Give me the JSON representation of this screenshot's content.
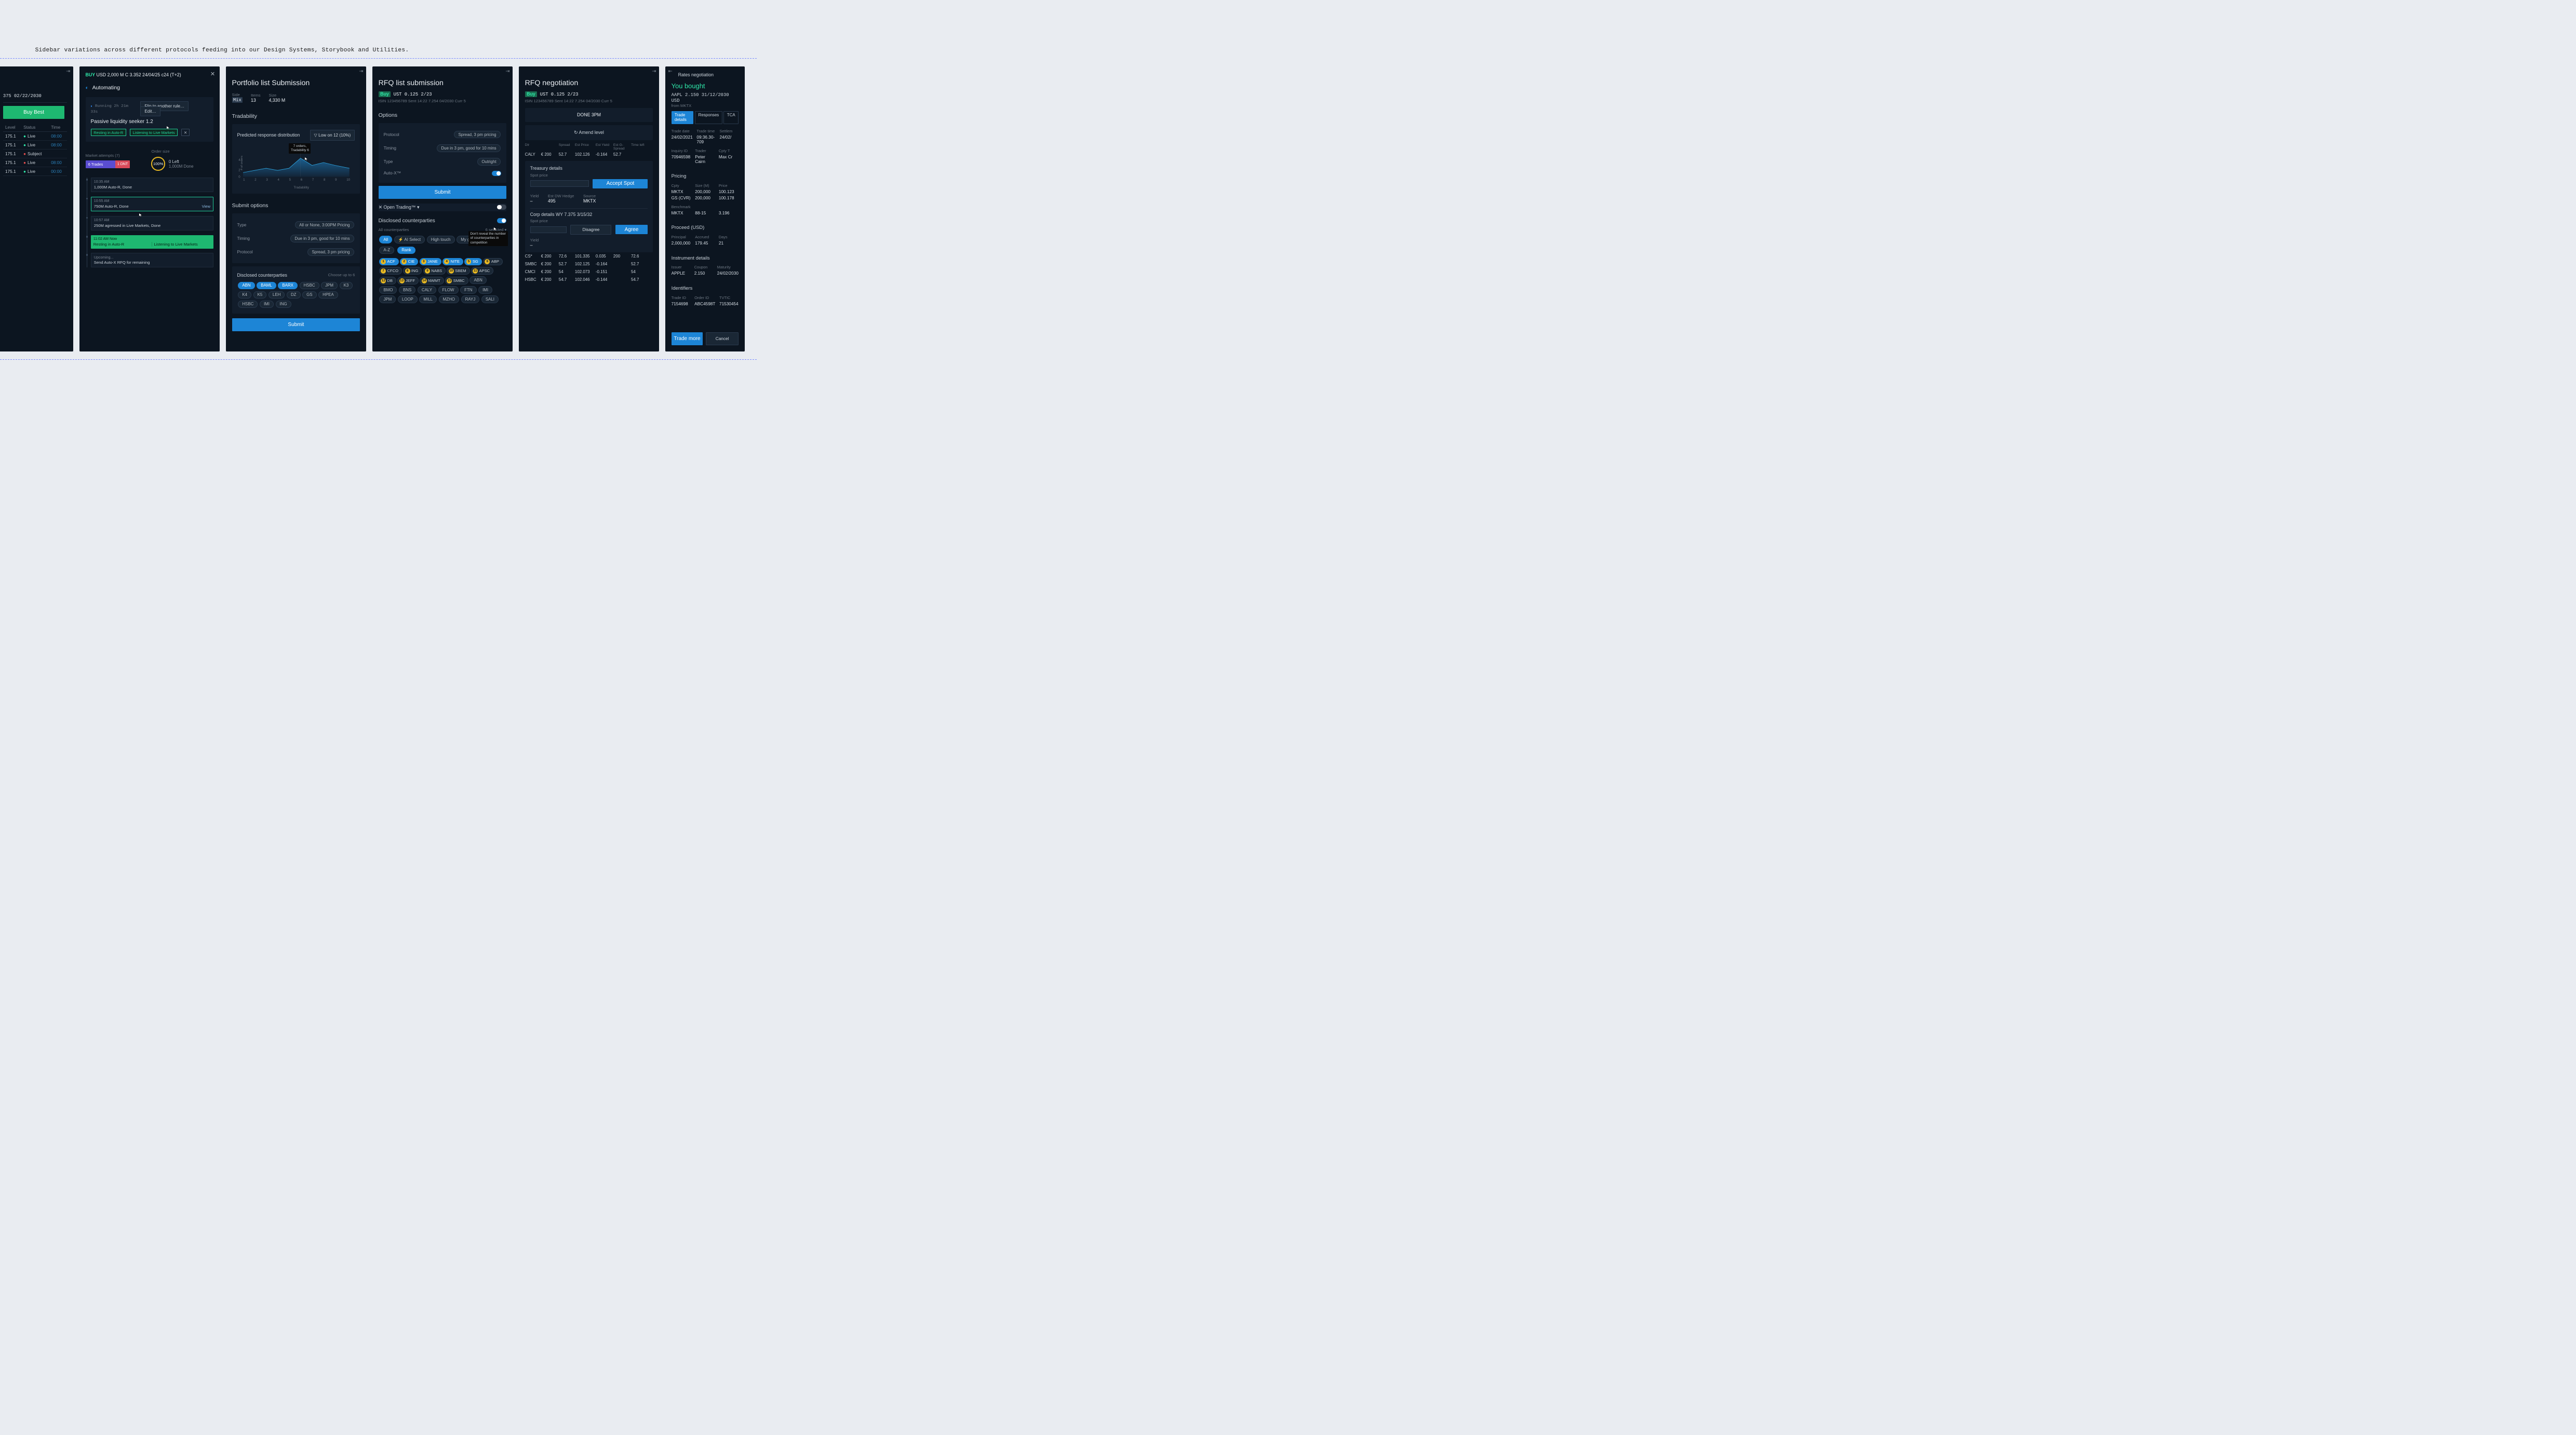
{
  "caption": "Sidebar variations across different protocols feeding into our Design Systems, Storybook and Utilities.",
  "p1": {
    "ticker": "375 02/22/2030",
    "buy_best": "Buy Best",
    "cols": [
      "Level",
      "Status",
      "Time"
    ],
    "rows": [
      {
        "level": "175.1",
        "status": "Live",
        "statusColor": "green",
        "time": "08:00"
      },
      {
        "level": "175.1",
        "status": "Live",
        "statusColor": "green",
        "time": "08:00"
      },
      {
        "level": "175.1",
        "status": "Subject",
        "statusColor": "red",
        "time": ""
      },
      {
        "level": "175.1",
        "status": "Live",
        "statusColor": "red",
        "time": "08:00"
      },
      {
        "level": "175.1",
        "status": "Live",
        "statusColor": "green",
        "time": "00:00"
      }
    ]
  },
  "p2": {
    "head_side": "BUY",
    "head_line": "USD 2,000 M C 3.352 24/04/25 c24 (T+2)",
    "automating": "Automating",
    "running": "Running 2h 21m 33s",
    "flip": "Flip to another rule…",
    "edit": "Edit…",
    "strategy": "Passive liquidity seeker 1.2",
    "rest": "Resting in Auto-R",
    "listen": "Listening to Live Markets",
    "market_attempts": "Market attempts (7)",
    "order_size": "Order size",
    "trades": "6 Trades",
    "dnt": "1 DNT",
    "ring": "100%",
    "left": "0 Left",
    "done": "1,000M Done",
    "timeline": [
      {
        "t": "10:35 AM",
        "txt": "1,000M Auto-R, Done",
        "view": false
      },
      {
        "t": "10:55 AM",
        "txt": "750M Auto-R, Done",
        "view": true
      },
      {
        "t": "10:57 AM",
        "txt": "250M agressed in Live Markets, Done",
        "view": false
      }
    ],
    "now_t": "11:02 AM  Now",
    "now_rest": "Resting in Auto-R",
    "now_listen": "Listening to Live Markets",
    "upcoming": "Upcoming...",
    "upcoming_txt": "Send Auto-X RFQ for remaining"
  },
  "p3": {
    "title": "Portfolio list Submission",
    "stats": [
      {
        "l": "Side",
        "v": "Mix"
      },
      {
        "l": "Items",
        "v": "13"
      },
      {
        "l": "Size",
        "v": "4,330 M"
      }
    ],
    "tradability": "Tradability",
    "pred_title": "Predicted response distribution",
    "filter": "Low on 12 (10%)",
    "tooltip": "7 orders,\nTradability 6",
    "y_label": "# of orders",
    "x_label": "Tradability",
    "submit_options": "Submit options",
    "type": "All or None, 3:00PM Pricing",
    "timing": "Due in 3 pm, good for 10 mins",
    "protocol": "Spread, 3 pm pricing",
    "disclosed": "Disclosed counterparties",
    "choose": "Choose up to 6",
    "cps_selected": [
      "ABN",
      "BAML",
      "BARX"
    ],
    "cps": [
      "HSBC",
      "JPM",
      "K3",
      "K4",
      "K5",
      "LEH",
      "DZ",
      "GS",
      "HPEA",
      "HSBC",
      "IMI",
      "ING"
    ],
    "submit": "Submit"
  },
  "p4": {
    "title": "RFQ list submission",
    "side": "Buy",
    "inst": "UST  0.125  2/23",
    "meta": "ISIN 123456789   Sent 14:22   7.254 04/2030 Curr 5",
    "options": "Options",
    "protocol": "Spread, 3 pm pricing",
    "timing": "Due in 3 pm, good for 10 mins",
    "type": "Outright",
    "autox": "Auto-X™",
    "submit": "Submit",
    "ot": "Open Trading™",
    "disclosed": "Disclosed counterparties",
    "all_cp": "All counterparties",
    "n_selected": "6 selected",
    "filters": [
      "All",
      "AI Select",
      "High touch",
      "My g"
    ],
    "sort_az": "A-Z",
    "sort_rank": "Rank",
    "tooltip": "Don't reveal the number of counterparties in competition",
    "cps_ranked": [
      {
        "r": 1,
        "n": "ACF",
        "sel": true
      },
      {
        "r": 2,
        "n": "CIE",
        "sel": true
      },
      {
        "r": 3,
        "n": "JANE",
        "sel": true
      },
      {
        "r": 4,
        "n": "NITE",
        "sel": true
      },
      {
        "r": 5,
        "n": "SG",
        "sel": true
      },
      {
        "r": 6,
        "n": "ABP"
      },
      {
        "r": 7,
        "n": "CFCO"
      },
      {
        "r": 8,
        "n": "ING"
      },
      {
        "r": 9,
        "n": "NABS"
      },
      {
        "r": 10,
        "n": "SBEM"
      },
      {
        "r": 11,
        "n": "APSC"
      },
      {
        "r": 12,
        "n": "DB"
      },
      {
        "r": 13,
        "n": "JEFF"
      },
      {
        "r": 14,
        "n": "NWMT"
      },
      {
        "r": 15,
        "n": "SMBC"
      }
    ],
    "cps_plain": [
      "ABN",
      "BMO",
      "BNS",
      "CALY",
      "FLOW",
      "FTN",
      "IMI",
      "JPM",
      "LOOP",
      "MILL",
      "MZHO",
      "RAYJ",
      "SALI"
    ]
  },
  "p5": {
    "title": "RFQ negotiation",
    "side": "Buy",
    "inst": "UST   0.125   2/23",
    "meta": "ISIN 123456789   Sent 14:22   7.254 04/2030 Curr 5",
    "done": "DONE 3PM",
    "amend": "Amend level",
    "qhead": [
      "Dlr",
      "",
      "Spread",
      "Est Price",
      "Est Yield",
      "Est G-Spread",
      "Time left"
    ],
    "caly": [
      "CALY",
      "€ 200",
      "52.7",
      "102.126",
      "-0.164",
      "52.7",
      ""
    ],
    "treasury": "Treasury details",
    "spot_price": "Spot price",
    "accept_spot": "Accept Spot",
    "yield": "Yield",
    "yield_v": "–",
    "hedge": "Est DW Hedge",
    "hedge_v": "495",
    "source": "Source",
    "source_v": "MKTX",
    "corp": "Corp details   WY 7.375 3/15/32",
    "agree": "Agree",
    "disagree": "Disagree",
    "quotes": [
      [
        "CS*",
        "€ 200",
        "72.6",
        "101.335",
        "0.035",
        "200",
        "72.6"
      ],
      [
        "SMBC",
        "€ 200",
        "52.7",
        "102.125",
        "-0.164",
        "",
        "52.7"
      ],
      [
        "CMCI",
        "€ 200",
        "54",
        "102.073",
        "-0.151",
        "",
        "54"
      ],
      [
        "HSBC",
        "€ 200",
        "54.7",
        "102.046",
        "-0.144",
        "",
        "54.7"
      ]
    ]
  },
  "p6": {
    "title": "Rates negotiation",
    "you_bought": "You bought",
    "inst": "AAPL 2.150 31/12/2030  USD",
    "from": "from MKTX",
    "tabs": [
      "Trade details",
      "Responses",
      "TCA"
    ],
    "active_tab": 0,
    "rows1": [
      [
        "Trade date",
        "Trade time",
        "Settlem"
      ],
      [
        "24/02/2021",
        "09:36.30-709",
        "24/02/"
      ]
    ],
    "rows2": [
      [
        "Inquiry ID",
        "Trader",
        "Cpty T"
      ],
      [
        "70946598",
        "Peter Cairn",
        "Max Cr"
      ]
    ],
    "pricing": "Pricing",
    "price_head": [
      "Cpty",
      "Size (M)",
      "Price"
    ],
    "price_rows": [
      [
        "MKTX",
        "200,000",
        "100.123"
      ],
      [
        "GS (CVR)",
        "200,000",
        "100.178"
      ]
    ],
    "bench": [
      "Benchmark",
      "",
      ""
    ],
    "bench_row": [
      "MKTX",
      "88-15",
      "3.196"
    ],
    "proceed": "Proceed (USD)",
    "proceed_head": [
      "Principal",
      "Accrued",
      "Days"
    ],
    "proceed_row": [
      "2,000,000",
      "179.45",
      "21"
    ],
    "instr": "Instrument details",
    "instr_head": [
      "Issuer",
      "Coupon",
      "Maturity"
    ],
    "instr_row": [
      "APPLE",
      "2.150",
      "24/02/2030"
    ],
    "ident": "Identifiers",
    "ident_head": [
      "Trade ID",
      "Order ID",
      "TVTIC"
    ],
    "ident_row": [
      "7154698",
      "ABC4598T",
      "71530454"
    ],
    "trade_more": "Trade more",
    "cancel": "Cancel"
  },
  "chart_data": {
    "type": "area",
    "title": "Predicted response distribution",
    "xlabel": "Tradability",
    "ylabel": "# of orders",
    "x": [
      1,
      2,
      3,
      4,
      5,
      6,
      7,
      8,
      9,
      10
    ],
    "y": [
      2,
      3,
      4,
      3,
      4,
      7,
      5,
      6,
      5,
      4
    ],
    "ylim": [
      0,
      8
    ],
    "annotation": {
      "x": 6,
      "y": 7,
      "text": "7 orders, Tradability 6"
    }
  }
}
